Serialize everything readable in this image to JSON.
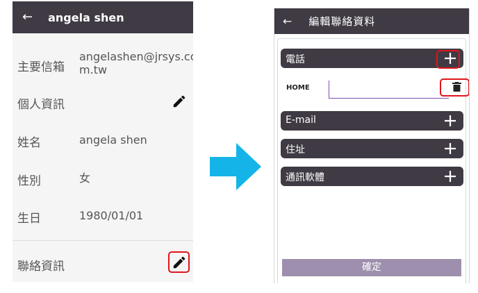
{
  "left_screen": {
    "back_icon": "arrow-left-icon",
    "title": "angela shen",
    "fields": [
      {
        "label": "主要信箱",
        "value_line1": "angelashen@jrsys.co",
        "value_line2": "m.tw"
      },
      {
        "label": "個人資訊",
        "icon": "pencil-icon"
      },
      {
        "label": "姓名",
        "value": "angela shen"
      },
      {
        "label": "性別",
        "value": "女"
      },
      {
        "label": "生日",
        "value": "1980/01/01"
      },
      {
        "label": "聯絡資訊",
        "icon": "pencil-icon",
        "highlighted": true
      }
    ]
  },
  "transition_arrow": {
    "icon": "arrow-right-icon",
    "color": "#14b4e8"
  },
  "right_screen": {
    "back_icon": "arrow-left-icon",
    "title": "編輯聯絡資料",
    "sections": [
      {
        "label": "電話",
        "icon": "plus-icon",
        "highlighted": true
      },
      {
        "label": "E-mail",
        "icon": "plus-icon"
      },
      {
        "label": "住址",
        "icon": "plus-icon"
      },
      {
        "label": "通訊軟體",
        "icon": "plus-icon"
      }
    ],
    "phone_entry": {
      "type_label": "HOME",
      "value": "",
      "delete_icon": "trash-icon",
      "delete_highlighted": true
    },
    "confirm_label": "確定"
  },
  "colors": {
    "appbar": "#3f3a43",
    "section_bar": "#3f3a43",
    "highlight": "#e0151b",
    "confirm_button": "#9e8fae",
    "arrow": "#14b4e8"
  }
}
